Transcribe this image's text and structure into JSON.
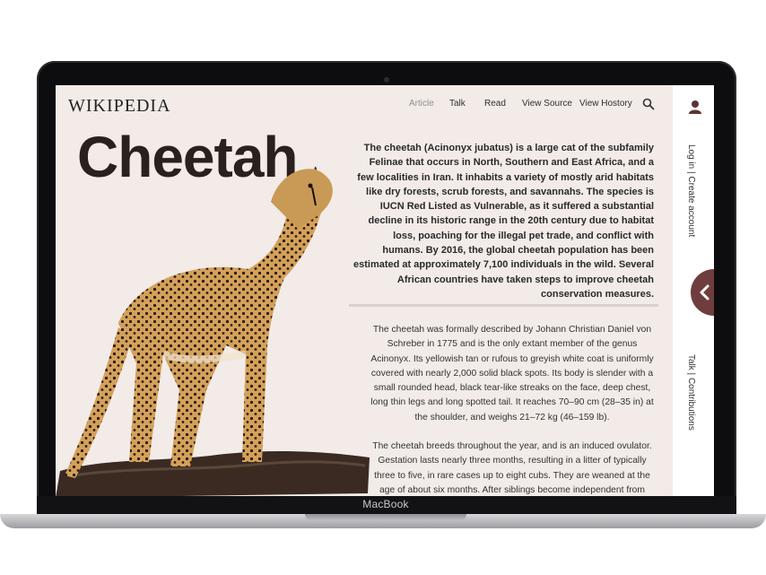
{
  "device": {
    "brand": "MacBook"
  },
  "header": {
    "logo": "WIKIPEDIA",
    "tabs": [
      {
        "label": "Article",
        "active": true
      },
      {
        "label": "Talk"
      },
      {
        "label": "Read"
      },
      {
        "label": "View Source"
      },
      {
        "label": "View Hostory"
      }
    ],
    "search_icon": "search-icon"
  },
  "article": {
    "title": "Cheetah",
    "lead": "The cheetah (Acinonyx jubatus) is a large cat of the subfamily Felinae that occurs in North, Southern and East Africa, and a few localities in Iran. It inhabits a variety of mostly arid habitats like dry forests, scrub forests, and savannahs. The species is IUCN Red Listed as Vulnerable, as it suffered a substantial decline in its historic range in the 20th century due to habitat loss, poaching for the illegal pet trade, and conflict with humans. By 2016, the global cheetah population has been estimated at approximately 7,100 individuals in the wild. Several African countries have taken steps to improve cheetah conservation measures.",
    "paragraphs": [
      "The cheetah was formally described by Johann Christian Daniel von Schreber in 1775 and is the only extant member of the genus Acinonyx. Its yellowish tan or rufous to greyish white coat is uniformly covered with nearly 2,000 solid black spots. Its body is slender with a small rounded head, black tear-like streaks on the face, deep chest, long thin legs and long spotted tail. It reaches 70–90 cm (28–35 in) at the shoulder, and weighs 21–72 kg (46–159 lb).",
      "The cheetah breeds throughout the year, and is an induced ovulator. Gestation lasts nearly three months, resulting in a litter of typically three to five, in rare cases up to eight cubs. They are weaned at the age of about six months. After siblings become independent from"
    ]
  },
  "sidebar": {
    "user_icon": "user-icon",
    "account_links": "Log in  |  Create account",
    "user_links": "Talk  |  Contributions",
    "collapse_icon": "chevron-left-icon"
  },
  "colors": {
    "screen_bg": "#f2ebe8",
    "accent": "#6f3d3d"
  }
}
